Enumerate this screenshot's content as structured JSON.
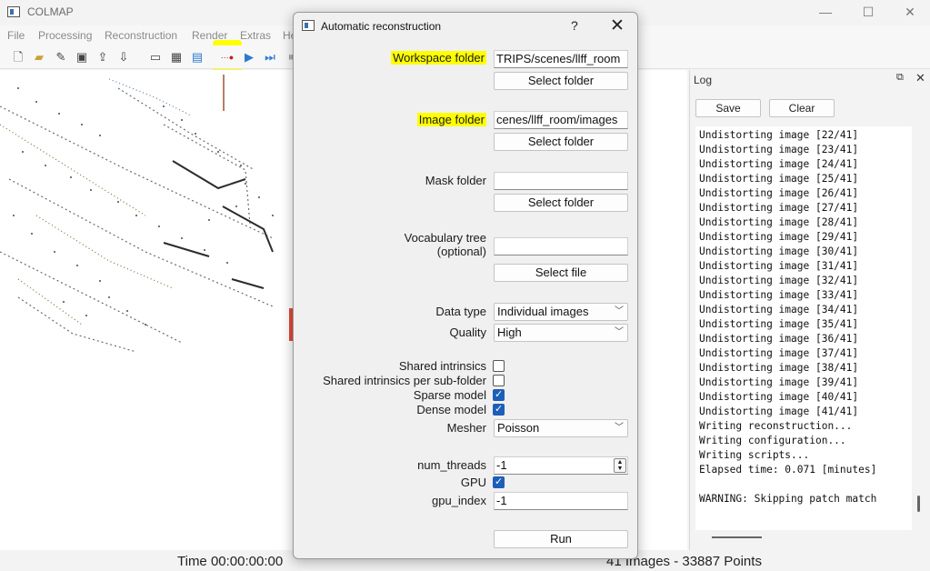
{
  "window": {
    "title": "COLMAP"
  },
  "menu": [
    "File",
    "Processing",
    "Reconstruction",
    "Render",
    "Extras",
    "He"
  ],
  "status": {
    "time": "Time 00:00:00:00",
    "points": "41 Images - 33887 Points"
  },
  "log": {
    "title": "Log",
    "save_label": "Save",
    "clear_label": "Clear",
    "lines": [
      "Undistorting image [22/41]",
      "Undistorting image [23/41]",
      "Undistorting image [24/41]",
      "Undistorting image [25/41]",
      "Undistorting image [26/41]",
      "Undistorting image [27/41]",
      "Undistorting image [28/41]",
      "Undistorting image [29/41]",
      "Undistorting image [30/41]",
      "Undistorting image [31/41]",
      "Undistorting image [32/41]",
      "Undistorting image [33/41]",
      "Undistorting image [34/41]",
      "Undistorting image [35/41]",
      "Undistorting image [36/41]",
      "Undistorting image [37/41]",
      "Undistorting image [38/41]",
      "Undistorting image [39/41]",
      "Undistorting image [40/41]",
      "Undistorting image [41/41]",
      "Writing reconstruction...",
      "Writing configuration...",
      "Writing scripts...",
      "Elapsed time: 0.071 [minutes]",
      "",
      "WARNING: Skipping patch match"
    ]
  },
  "dialog": {
    "title": "Automatic reconstruction",
    "help": "?",
    "workspace_label": "Workspace folder",
    "workspace_value": "TRIPS/scenes/llff_room",
    "image_label": "Image folder",
    "image_value": "cenes/llff_room/images",
    "mask_label": "Mask folder",
    "mask_value": "",
    "vocab_label_1": "Vocabulary tree",
    "vocab_label_2": "(optional)",
    "vocab_value": "",
    "select_folder": "Select folder",
    "select_file": "Select file",
    "data_type_label": "Data type",
    "data_type_value": "Individual images",
    "quality_label": "Quality",
    "quality_value": "High",
    "shared_intrinsics_label": "Shared intrinsics",
    "shared_intrinsics_sub_label": "Shared intrinsics per sub-folder",
    "sparse_label": "Sparse model",
    "dense_label": "Dense model",
    "mesher_label": "Mesher",
    "mesher_value": "Poisson",
    "num_threads_label": "num_threads",
    "num_threads_value": "-1",
    "gpu_label": "GPU",
    "gpu_index_label": "gpu_index",
    "gpu_index_value": "-1",
    "run_label": "Run"
  },
  "colors": {
    "highlight": "#ffff00",
    "checkbox_checked": "#1d5fb8"
  }
}
